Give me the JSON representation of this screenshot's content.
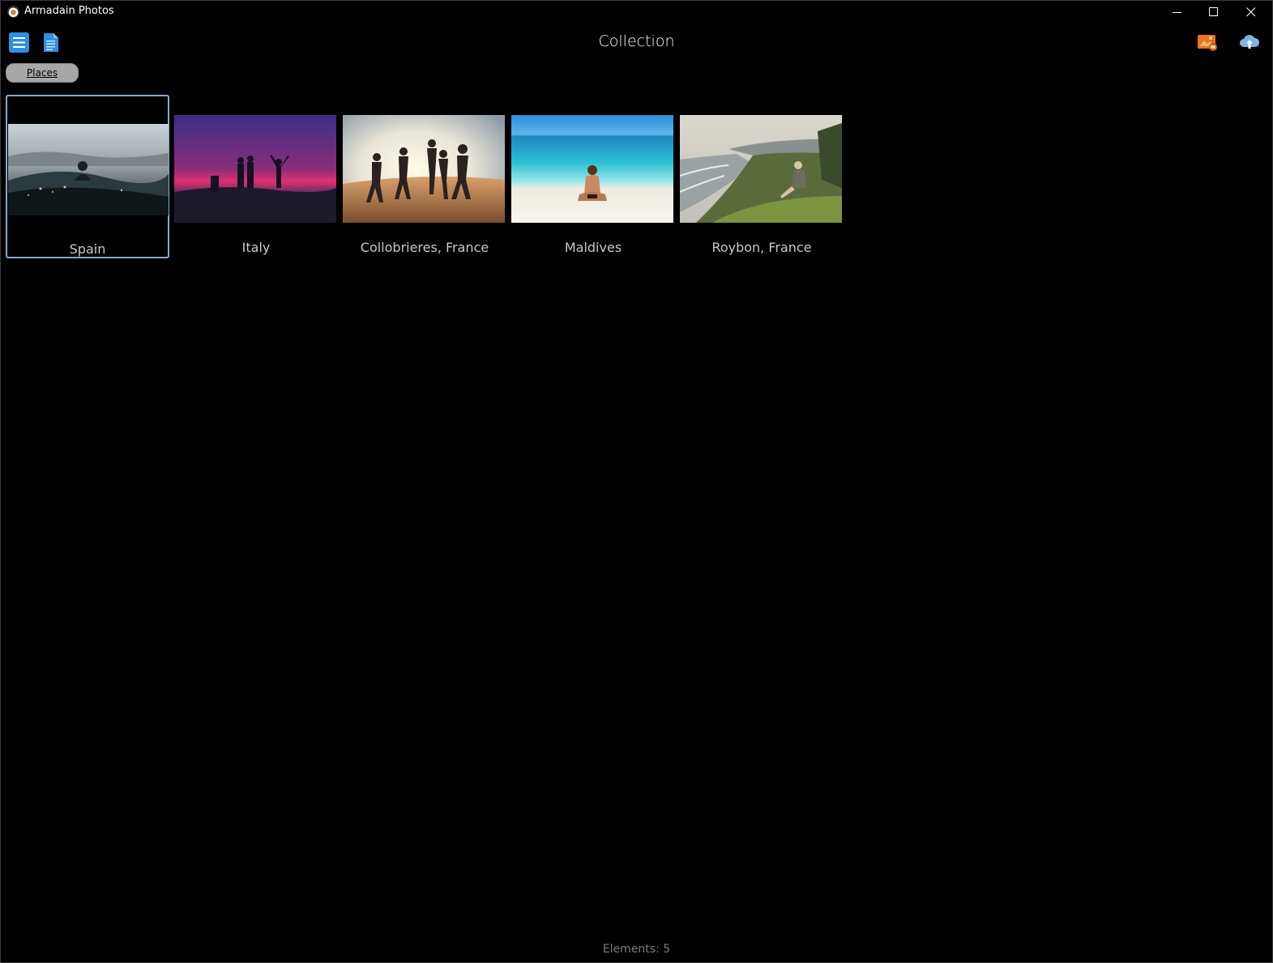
{
  "window": {
    "title": "Armadain Photos"
  },
  "header": {
    "page_title": "Collection"
  },
  "breadcrumb": {
    "label": "Places"
  },
  "places": [
    {
      "label": "Spain"
    },
    {
      "label": "Italy"
    },
    {
      "label": "Collobrieres, France"
    },
    {
      "label": "Maldives"
    },
    {
      "label": "Roybon, France"
    }
  ],
  "status": {
    "text": "Elements: 5"
  },
  "icons": {
    "menu": "hamburger-menu-icon",
    "document": "document-icon",
    "photos": "photos-icon",
    "upload": "cloud-upload-icon"
  },
  "colors": {
    "accent": "#2f8fe0",
    "selection": "#8aa8c8"
  }
}
